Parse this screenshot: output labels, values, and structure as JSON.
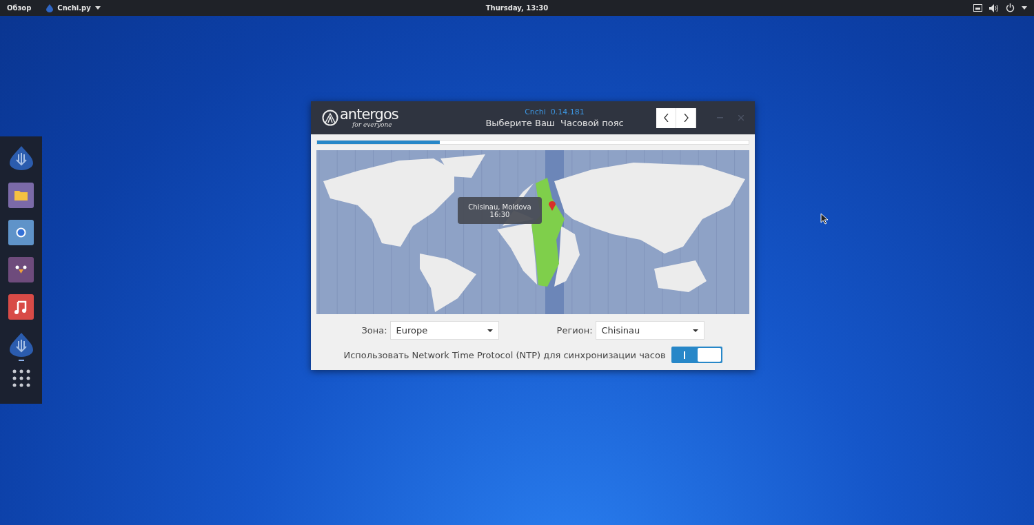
{
  "top_bar": {
    "activities": "Обзор",
    "app_menu": "Cnchi.py",
    "clock": "Thursday, 13:30"
  },
  "dock": {
    "items": [
      {
        "kind": "installer",
        "running": false
      },
      {
        "kind": "files",
        "running": false
      },
      {
        "kind": "browser",
        "running": false
      },
      {
        "kind": "messenger",
        "running": false
      },
      {
        "kind": "music",
        "running": false
      },
      {
        "kind": "installer",
        "running": true
      },
      {
        "kind": "apps",
        "running": false
      }
    ]
  },
  "window": {
    "logo": {
      "name": "antergos",
      "tagline": "for everyone"
    },
    "app_version": "Cnchi  0.14.181",
    "title": "Выберите Ваш  Часовой пояс",
    "progress": {
      "level": 0.284
    },
    "map": {
      "tooltip": {
        "place": "Chisinau, Moldova",
        "time": "16:30"
      }
    },
    "zone": {
      "label": "Зона:",
      "value": "Europe"
    },
    "region": {
      "label": "Регион:",
      "value": "Chisinau"
    },
    "ntp": {
      "label": "Использовать Network Time Protocol (NTP) для синхронизации часов",
      "on": true
    }
  }
}
